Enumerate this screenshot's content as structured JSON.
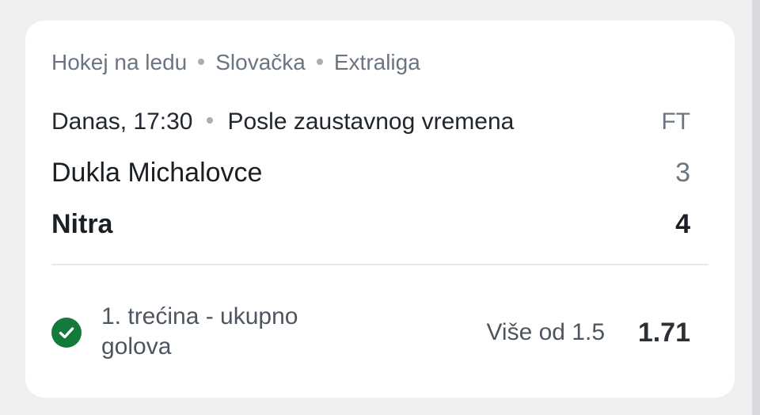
{
  "breadcrumb": {
    "sport": "Hokej na ledu",
    "country": "Slovačka",
    "league": "Extraliga"
  },
  "match": {
    "datetime": "Danas, 17:30",
    "result_type": "Posle zaustavnog vremena",
    "status": "FT",
    "home_team": "Dukla Michalovce",
    "home_score": "3",
    "away_team": "Nitra",
    "away_score": "4"
  },
  "bet": {
    "market": "1. trećina - ukupno golova",
    "selection": "Više od 1.5",
    "odds": "1.71",
    "status_icon": "check-circle-icon",
    "status_color": "#137a3b"
  }
}
